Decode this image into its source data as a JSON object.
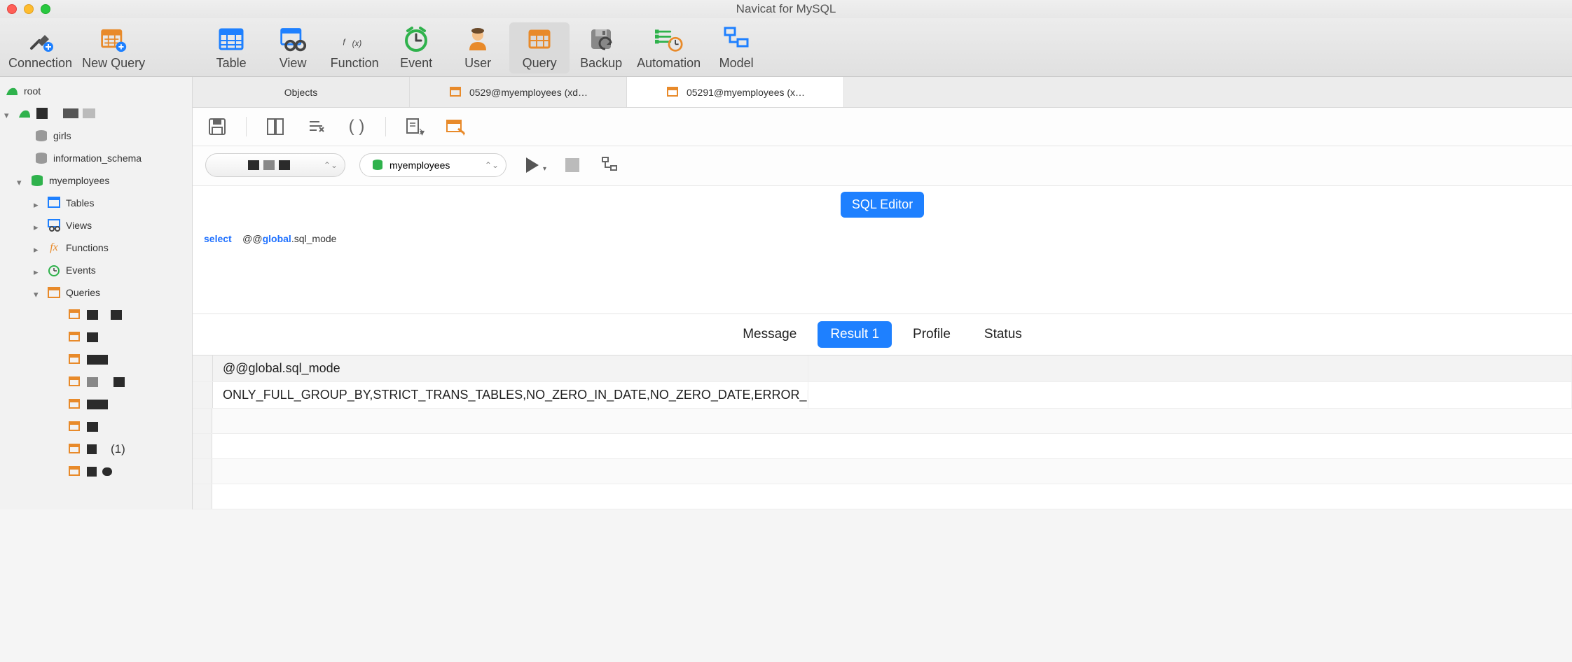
{
  "window": {
    "title": "Navicat for MySQL"
  },
  "toolbar": {
    "connection": "Connection",
    "new_query": "New Query",
    "table": "Table",
    "view": "View",
    "function": "Function",
    "event": "Event",
    "user": "User",
    "query": "Query",
    "backup": "Backup",
    "automation": "Automation",
    "model": "Model"
  },
  "sidebar": {
    "root": "root",
    "girls": "girls",
    "info_schema": "information_schema",
    "myemployees": "myemployees",
    "tables": "Tables",
    "views": "Views",
    "functions": "Functions",
    "events": "Events",
    "queries": "Queries",
    "query_count_suffix": "(1)"
  },
  "tabs": {
    "objects": "Objects",
    "q1": "0529@myemployees (xd…",
    "q2": "05291@myemployees (x…"
  },
  "selectors": {
    "database_label": "myemployees"
  },
  "buttons": {
    "sql_editor": "SQL Editor"
  },
  "sql": {
    "select": "select",
    "at": "@@",
    "global": "global",
    "rest": ".sql_mode"
  },
  "result_tabs": {
    "message": "Message",
    "result1": "Result 1",
    "profile": "Profile",
    "status": "Status"
  },
  "grid": {
    "col1_header": "@@global.sql_mode",
    "row1_col1": "ONLY_FULL_GROUP_BY,STRICT_TRANS_TABLES,NO_ZERO_IN_DATE,NO_ZERO_DATE,ERROR_FOR_DIVISION_BY_ZER"
  }
}
